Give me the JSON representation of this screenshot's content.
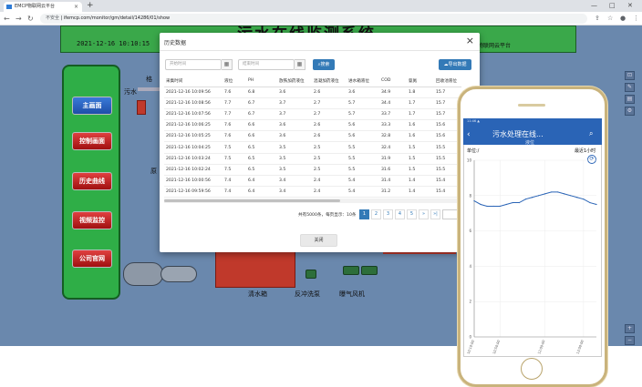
{
  "browser": {
    "tab_title": "EMCP物联网云平台",
    "address_warning": "不安全",
    "url": "ifemcp.com/monitor/gm/detail/14286/01/show"
  },
  "scada": {
    "system_title": "污水在线监测系统",
    "datetime": "2021-12-16  10:10:15",
    "platform": "物联网云平台",
    "menu": [
      "主画面",
      "控制画面",
      "历史曲线",
      "视频监控",
      "公司官网"
    ],
    "labels": {
      "sewage_in": "污水",
      "clear_tank": "清水箱",
      "backwash_pump": "反冲洗泵",
      "aeration_fan": "曝气风机",
      "left_lbl1": "格",
      "left_lbl2": "原"
    }
  },
  "modal": {
    "title": "历史数据",
    "start_placeholder": "开始时间",
    "end_placeholder": "结束时间",
    "search_label": "搜索",
    "export_label": "导出数据",
    "columns": [
      "采集时间",
      "液位",
      "PH",
      "放铁加药液位",
      "混凝加药液位",
      "进水箱液位",
      "COD",
      "氨氮",
      "回收池液位"
    ],
    "rows": [
      [
        "2021-12-16 10:09:56",
        "7.6",
        "6.8",
        "3.6",
        "2.6",
        "3.6",
        "34.9",
        "1.8",
        "15.7"
      ],
      [
        "2021-12-16 10:08:56",
        "7.7",
        "6.7",
        "3.7",
        "2.7",
        "5.7",
        "34.4",
        "1.7",
        "15.7"
      ],
      [
        "2021-12-16 10:07:56",
        "7.7",
        "6.7",
        "3.7",
        "2.7",
        "5.7",
        "33.7",
        "1.7",
        "15.7"
      ],
      [
        "2021-12-16 10:06:25",
        "7.6",
        "6.6",
        "3.6",
        "2.6",
        "5.6",
        "33.3",
        "1.6",
        "15.6"
      ],
      [
        "2021-12-16 10:05:25",
        "7.6",
        "6.6",
        "3.6",
        "2.6",
        "5.6",
        "32.8",
        "1.6",
        "15.6"
      ],
      [
        "2021-12-16 10:04:25",
        "7.5",
        "6.5",
        "3.5",
        "2.5",
        "5.5",
        "32.4",
        "1.5",
        "15.5"
      ],
      [
        "2021-12-16 10:03:24",
        "7.5",
        "6.5",
        "3.5",
        "2.5",
        "5.5",
        "31.9",
        "1.5",
        "15.5"
      ],
      [
        "2021-12-16 10:02:24",
        "7.5",
        "6.5",
        "3.5",
        "2.5",
        "5.5",
        "31.6",
        "1.5",
        "15.5"
      ],
      [
        "2021-12-16 10:00:56",
        "7.4",
        "6.4",
        "3.4",
        "2.4",
        "5.4",
        "31.4",
        "1.4",
        "15.4"
      ],
      [
        "2021-12-16 09:59:56",
        "7.4",
        "6.4",
        "3.4",
        "2.4",
        "5.4",
        "31.2",
        "1.4",
        "15.4"
      ]
    ],
    "pagination_info": "共有5000条，每页显示：10条",
    "pages": [
      "1",
      "2",
      "3",
      "4",
      "5",
      "»",
      "»|"
    ],
    "close_label": "关闭"
  },
  "phone": {
    "status": "11:46 ▲",
    "title": "污水处理在线...",
    "subtitle": "液位",
    "unit_label": "单位:/",
    "range_label": "最近1小时",
    "chart_data": {
      "type": "line",
      "ylim": [
        0,
        10
      ],
      "yticks": [
        "0",
        "2",
        "4",
        "6",
        "8",
        "10"
      ],
      "x": [
        "10:10:00",
        "10:20:00",
        "10:30:00",
        "10:40:00",
        "10:50:00",
        "11:00:00",
        "11:10:00",
        "11:20:00",
        "11:30:00",
        "11:40:00",
        "11:50:00",
        "12:00:00",
        "12:10:00",
        "12:20:00",
        "12:30:00",
        "12:40:00",
        "12:50:00",
        "13:00:00",
        "13:10:00",
        "13:20:00"
      ],
      "xtick_labels": [
        "10:10:00",
        "10:50:00",
        "12:00:00",
        "13:00:00"
      ],
      "values": [
        7.7,
        7.5,
        7.4,
        7.4,
        7.4,
        7.5,
        7.6,
        7.6,
        7.8,
        7.9,
        8.0,
        8.1,
        8.2,
        8.2,
        8.1,
        8.0,
        7.9,
        7.8,
        7.6,
        7.5
      ],
      "line_color": "#2a64b6"
    }
  }
}
